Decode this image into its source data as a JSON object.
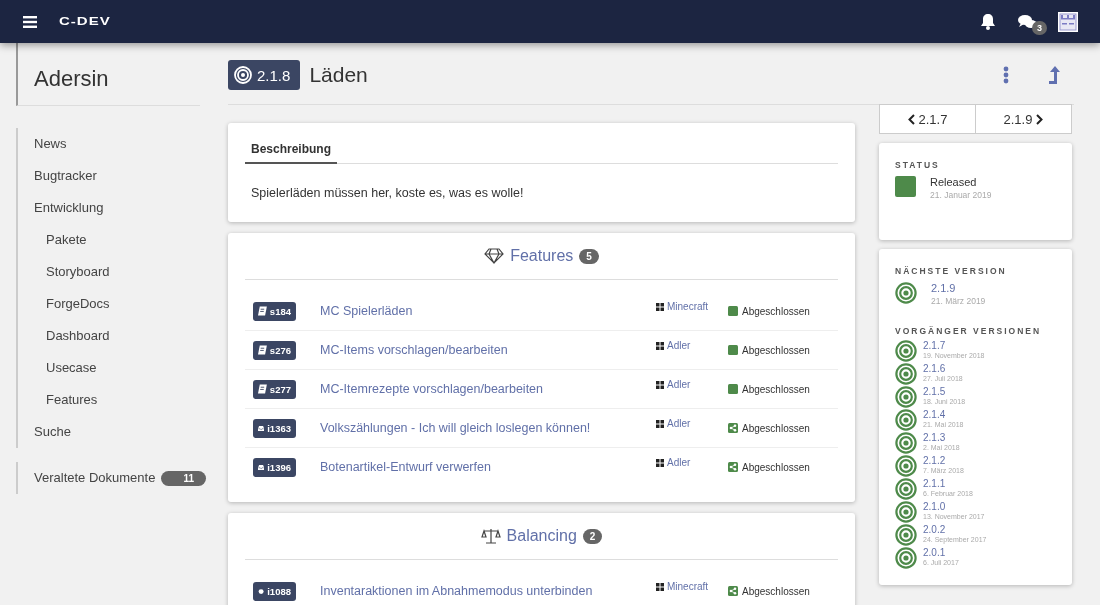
{
  "topbar": {
    "logo": "C-DEV",
    "chat_count": "3"
  },
  "sidebar": {
    "title": "Adersin",
    "items": [
      {
        "label": "News"
      },
      {
        "label": "Bugtracker"
      },
      {
        "label": "Entwicklung",
        "children": [
          {
            "label": "Pakete"
          },
          {
            "label": "Storyboard"
          },
          {
            "label": "ForgeDocs"
          },
          {
            "label": "Dashboard"
          },
          {
            "label": "Usecase"
          },
          {
            "label": "Features"
          }
        ]
      },
      {
        "label": "Suche"
      }
    ],
    "archive": {
      "label": "Veraltete Dokumente",
      "count": "11"
    }
  },
  "header": {
    "version": "2.1.8",
    "title": "Läden"
  },
  "description": {
    "tab": "Beschreibung",
    "text": "Spielerläden müssen her, koste es, was es wolle!"
  },
  "sections": [
    {
      "kind": "features",
      "title": "Features",
      "count": "5",
      "items": [
        {
          "kind": "story",
          "id": "s184",
          "title": "MC Spielerläden",
          "project": "Minecraft",
          "status": {
            "kind": "square",
            "label": "Abgeschlossen"
          }
        },
        {
          "kind": "story",
          "id": "s276",
          "title": "MC-Items vorschlagen/bearbeiten",
          "project": "Adler",
          "status": {
            "kind": "square",
            "label": "Abgeschlossen"
          }
        },
        {
          "kind": "story",
          "id": "s277",
          "title": "MC-Itemrezepte vorschlagen/bearbeiten",
          "project": "Adler",
          "status": {
            "kind": "square",
            "label": "Abgeschlossen"
          }
        },
        {
          "kind": "issue",
          "id": "i1363",
          "title": "Volkszählungen - Ich will gleich loslegen können!",
          "project": "Adler",
          "status": {
            "kind": "share",
            "label": "Abgeschlossen"
          }
        },
        {
          "kind": "issue",
          "id": "i1396",
          "title": "Botenartikel-Entwurf verwerfen",
          "project": "Adler",
          "status": {
            "kind": "share",
            "label": "Abgeschlossen"
          }
        }
      ]
    },
    {
      "kind": "balancing",
      "title": "Balancing",
      "count": "2",
      "items": [
        {
          "kind": "bug",
          "id": "i1088",
          "title": "Inventaraktionen im Abnahmemodus unterbinden",
          "project": "Minecraft",
          "status": {
            "kind": "share",
            "label": "Abgeschlossen"
          }
        }
      ]
    }
  ],
  "pager": {
    "prev": "2.1.7",
    "next": "2.1.9"
  },
  "status": {
    "heading": "STATUS",
    "label": "Released",
    "date": "21. Januar 2019"
  },
  "next_version": {
    "heading": "NÄCHSTE VERSION",
    "version": "2.1.9",
    "date": "21. März 2019"
  },
  "previous_versions": {
    "heading": "VORGÄNGER VERSIONEN",
    "items": [
      {
        "version": "2.1.7",
        "date": "19. November 2018"
      },
      {
        "version": "2.1.6",
        "date": "27. Juli 2018"
      },
      {
        "version": "2.1.5",
        "date": "18. Juni 2018"
      },
      {
        "version": "2.1.4",
        "date": "21. Mai 2018"
      },
      {
        "version": "2.1.3",
        "date": "2. Mai 2018"
      },
      {
        "version": "2.1.2",
        "date": "7. März 2018"
      },
      {
        "version": "2.1.1",
        "date": "6. Februar 2018"
      },
      {
        "version": "2.1.0",
        "date": "13. November 2017"
      },
      {
        "version": "2.0.2",
        "date": "24. September 2017"
      },
      {
        "version": "2.0.1",
        "date": "6. Juli 2017"
      }
    ]
  }
}
